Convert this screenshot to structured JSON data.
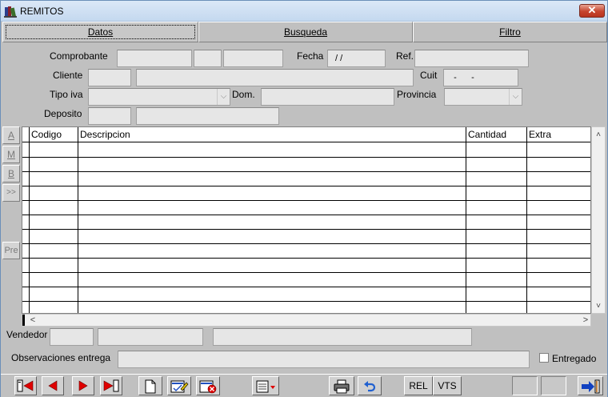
{
  "window": {
    "title": "REMITOS",
    "close": "✕"
  },
  "tabs": [
    {
      "label": "Datos"
    },
    {
      "label": "Busqueda"
    },
    {
      "label": "Filtro"
    }
  ],
  "form": {
    "comprobante_label": "Comprobante",
    "fecha_label": "Fecha",
    "fecha_value": " / /",
    "ref_label": "Ref.",
    "cliente_label": "Cliente",
    "cuit_label": "Cuit",
    "cuit_value": "  -      -",
    "tipo_iva_label": "Tipo iva",
    "dom_label": "Dom.",
    "provincia_label": "Provincia",
    "deposito_label": "Deposito"
  },
  "side_buttons": [
    "A",
    "M",
    "B",
    ">>",
    "Pre"
  ],
  "grid": {
    "columns": [
      "Codigo",
      "Descripcion",
      "Cantidad",
      "Extra"
    ],
    "scroll_up": "˄",
    "scroll_down": "˅",
    "scroll_left": "<",
    "scroll_right": ">"
  },
  "footer": {
    "vendedor_label": "Vendedor",
    "observaciones_label": "Observaciones entrega",
    "entregado_label": "Entregado",
    "entregado_checked": false
  },
  "toolbar": {
    "rel_label": "REL",
    "vts_label": "VTS",
    "icons": [
      "first-record-icon",
      "previous-record-icon",
      "next-record-icon",
      "last-record-icon",
      "new-document-icon",
      "edit-document-icon",
      "delete-document-icon",
      "form-dropdown-icon",
      "printer-icon",
      "undo-icon",
      "exit-icon"
    ]
  },
  "colors": {
    "title_bg": "#dbe8f7",
    "window_bg": "#c0c0c0",
    "close_red": "#c6442e",
    "nav_red": "#e00000",
    "field_bg": "#e6e6e6"
  }
}
